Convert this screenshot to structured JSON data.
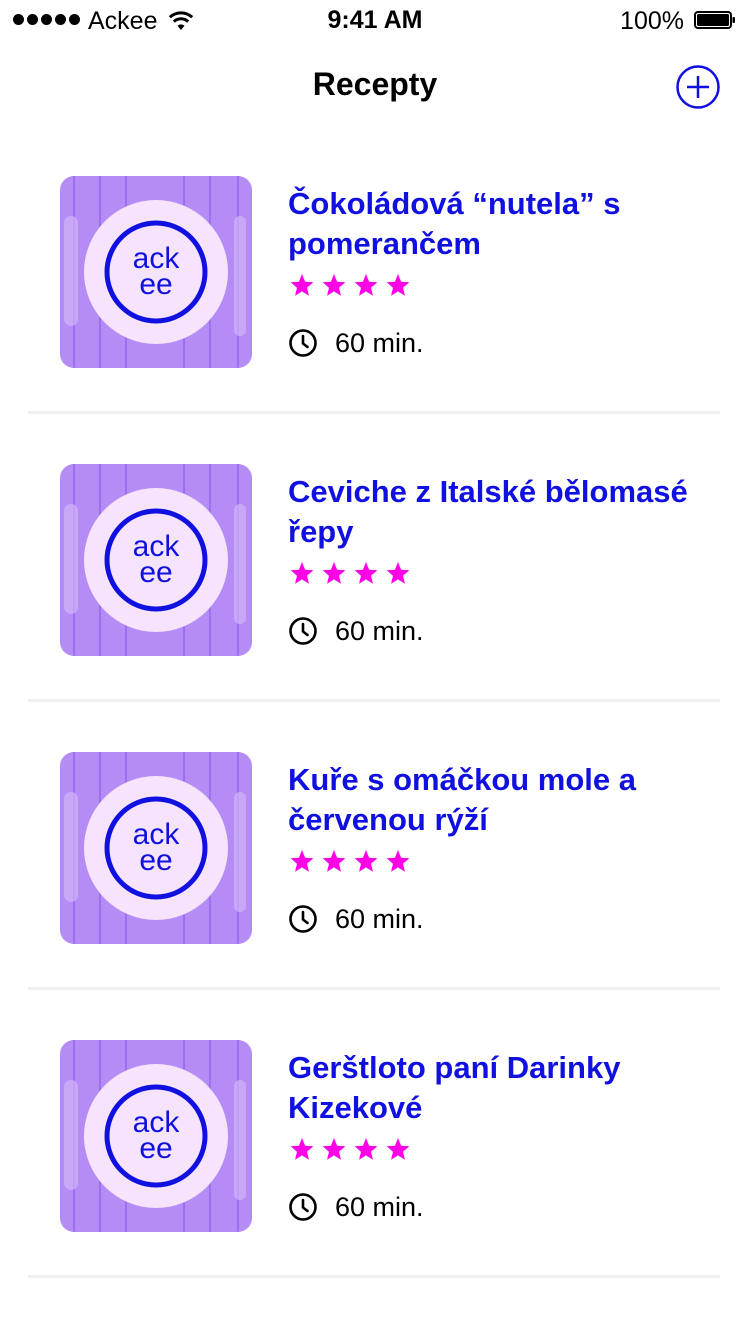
{
  "status_bar": {
    "carrier": "Ackee",
    "time": "9:41 AM",
    "battery": "100%"
  },
  "nav": {
    "title": "Recepty",
    "add_icon": "plus-circle-icon"
  },
  "colors": {
    "accent": "#1010E0",
    "star": "#FF00E6",
    "thumb_bg": "#B58CF5",
    "plate": "#F6E4FF"
  },
  "recipes": [
    {
      "title": "Čokoládová “nutela” s pomerančem",
      "rating": 4,
      "duration": "60 min.",
      "logo_top": "ack",
      "logo_bottom": "ee"
    },
    {
      "title": "Ceviche z Italské bělomasé řepy",
      "rating": 4,
      "duration": "60 min.",
      "logo_top": "ack",
      "logo_bottom": "ee"
    },
    {
      "title": "Kuře s omáčkou mole a červenou rýží",
      "rating": 4,
      "duration": "60 min.",
      "logo_top": "ack",
      "logo_bottom": "ee"
    },
    {
      "title": "Gerštloto paní Darinky Kizekové",
      "rating": 4,
      "duration": "60 min.",
      "logo_top": "ack",
      "logo_bottom": "ee"
    }
  ]
}
